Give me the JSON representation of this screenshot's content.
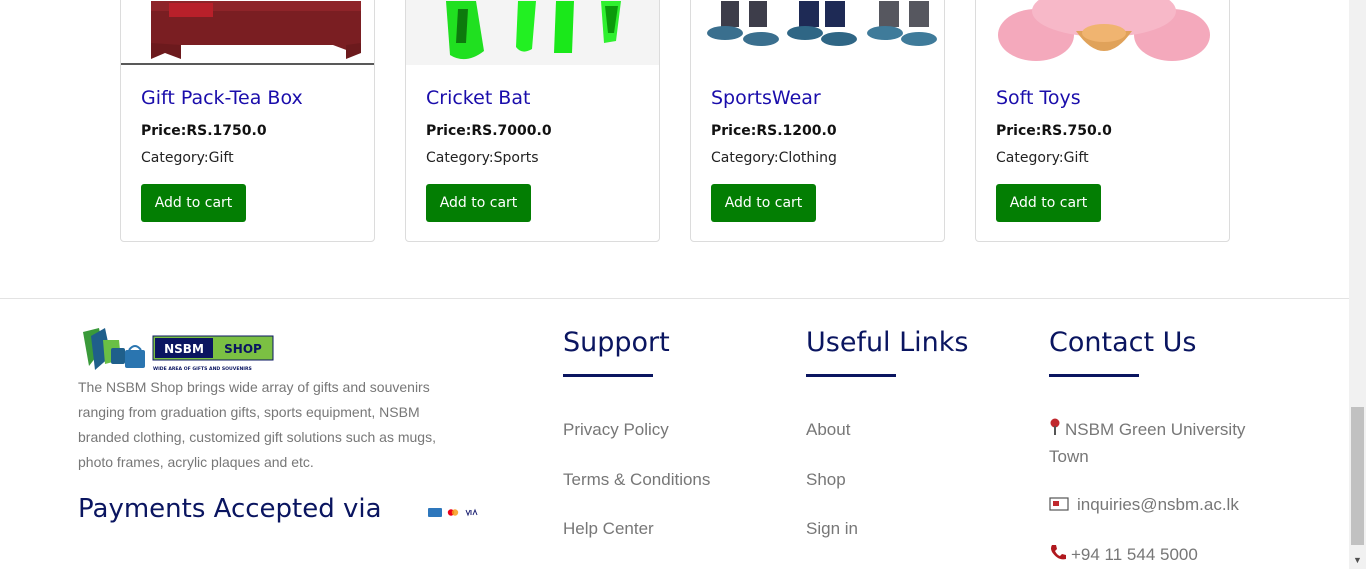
{
  "products": [
    {
      "title": "Gift Pack-Tea Box",
      "price": "Price:RS.1750.0",
      "category": "Category:Gift",
      "button": "Add to cart",
      "image": "tea-box-image"
    },
    {
      "title": "Cricket Bat",
      "price": "Price:RS.7000.0",
      "category": "Category:Sports",
      "button": "Add to cart",
      "image": "cricket-bat-image"
    },
    {
      "title": "SportsWear",
      "price": "Price:RS.1200.0",
      "category": "Category:Clothing",
      "button": "Add to cart",
      "image": "sportswear-image"
    },
    {
      "title": "Soft Toys",
      "price": "Price:RS.750.0",
      "category": "Category:Gift",
      "button": "Add to cart",
      "image": "soft-toys-image"
    }
  ],
  "footer": {
    "logo": {
      "brand": "NSBM",
      "shop": "SHOP",
      "tagline": "WIDE AREA OF GIFTS AND SOUVENIRS"
    },
    "about": "The NSBM Shop brings wide array of gifts and souvenirs ranging from graduation gifts, sports equipment, NSBM branded clothing, customized gift solutions such as mugs, photo frames, acrylic plaques and etc.",
    "payments_heading": "Payments Accepted via",
    "payment_icons": [
      "amex-icon",
      "mastercard-icon",
      "visa-icon"
    ],
    "support": {
      "heading": "Support",
      "links": [
        "Privacy Policy",
        "Terms & Conditions",
        "Help Center"
      ]
    },
    "useful_links": {
      "heading": "Useful Links",
      "links": [
        "About",
        "Shop",
        "Sign in"
      ]
    },
    "contact": {
      "heading": "Contact Us",
      "address": "NSBM Green University Town",
      "email": "inquiries@nsbm.ac.lk",
      "phone": "+94 11 544 5000"
    }
  },
  "colors": {
    "button": "#037e03",
    "heading": "#0a1560",
    "title_link": "#1a0dab",
    "muted_text": "#777777"
  }
}
